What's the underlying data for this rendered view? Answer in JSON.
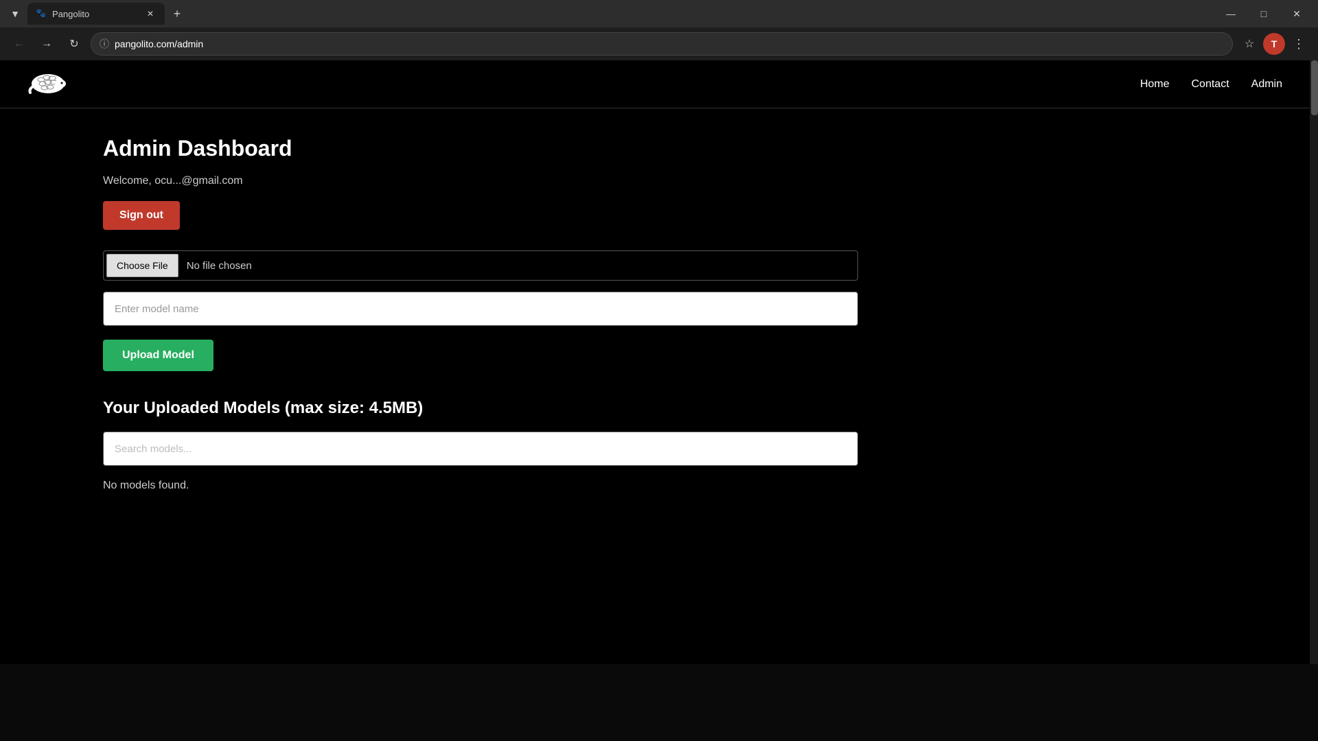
{
  "browser": {
    "tab": {
      "title": "Pangolito",
      "favicon": "🐱"
    },
    "url": "pangolito.com/admin",
    "nav": {
      "back_title": "Back",
      "forward_title": "Forward",
      "reload_title": "Reload"
    },
    "window_controls": {
      "minimize": "—",
      "maximize": "□",
      "close": "✕"
    },
    "profile_letter": "T"
  },
  "site": {
    "navbar": {
      "links": [
        {
          "label": "Home"
        },
        {
          "label": "Contact"
        },
        {
          "label": "Admin"
        }
      ]
    },
    "main": {
      "page_title": "Admin Dashboard",
      "welcome_text": "Welcome, ocu...@gmail.com",
      "sign_out_label": "Sign out",
      "file_input": {
        "button_label": "Choose File",
        "no_file_text": "No file chosen"
      },
      "model_name_placeholder": "Enter model name",
      "upload_button_label": "Upload Model",
      "models_section_title": "Your Uploaded Models (max size: 4.5MB)",
      "search_placeholder": "Search models...",
      "no_models_text": "No models found."
    }
  }
}
